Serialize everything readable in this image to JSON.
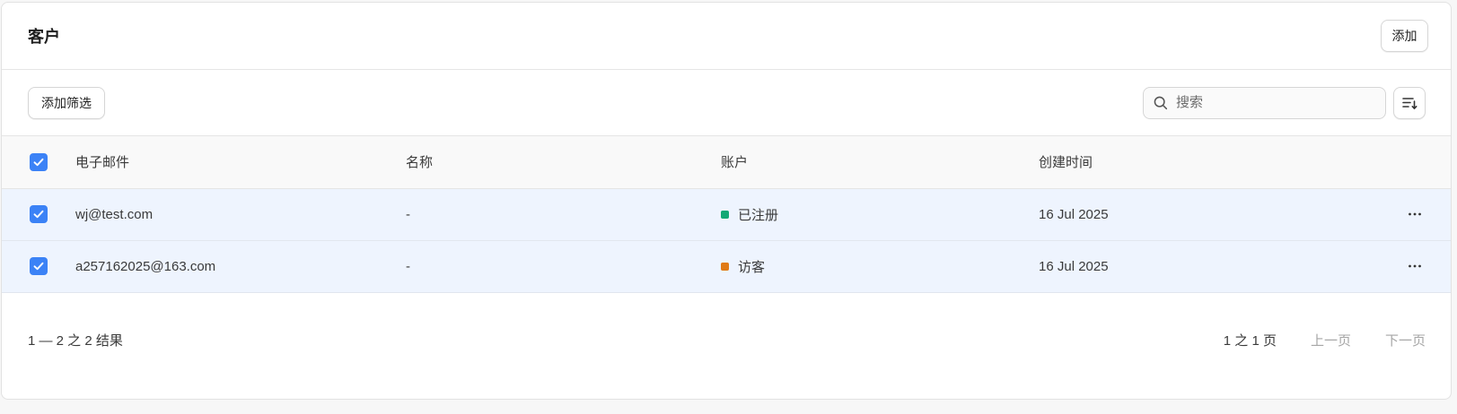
{
  "header": {
    "title": "客户",
    "add_label": "添加"
  },
  "toolbar": {
    "filter_label": "添加筛选",
    "search": {
      "placeholder": "搜索",
      "value": ""
    },
    "sort_icon": "sort-icon"
  },
  "table": {
    "columns": [
      "电子邮件",
      "名称",
      "账户",
      "创建时间"
    ],
    "select_all_checked": true,
    "rows": [
      {
        "checked": true,
        "email": "wj@test.com",
        "name": "-",
        "account": "已注册",
        "account_color": "#13a875",
        "created": "16 Jul 2025"
      },
      {
        "checked": true,
        "email": "a257162025@163.com",
        "name": "-",
        "account": "访客",
        "account_color": "#e07b16",
        "created": "16 Jul 2025"
      }
    ]
  },
  "footer": {
    "results": "1 — 2 之 2 结果",
    "page_info": "1 之 1 页",
    "prev_label": "上一页",
    "next_label": "下一页"
  },
  "colors": {
    "accent": "#3b82f6",
    "selected_row": "#eef4fe"
  }
}
